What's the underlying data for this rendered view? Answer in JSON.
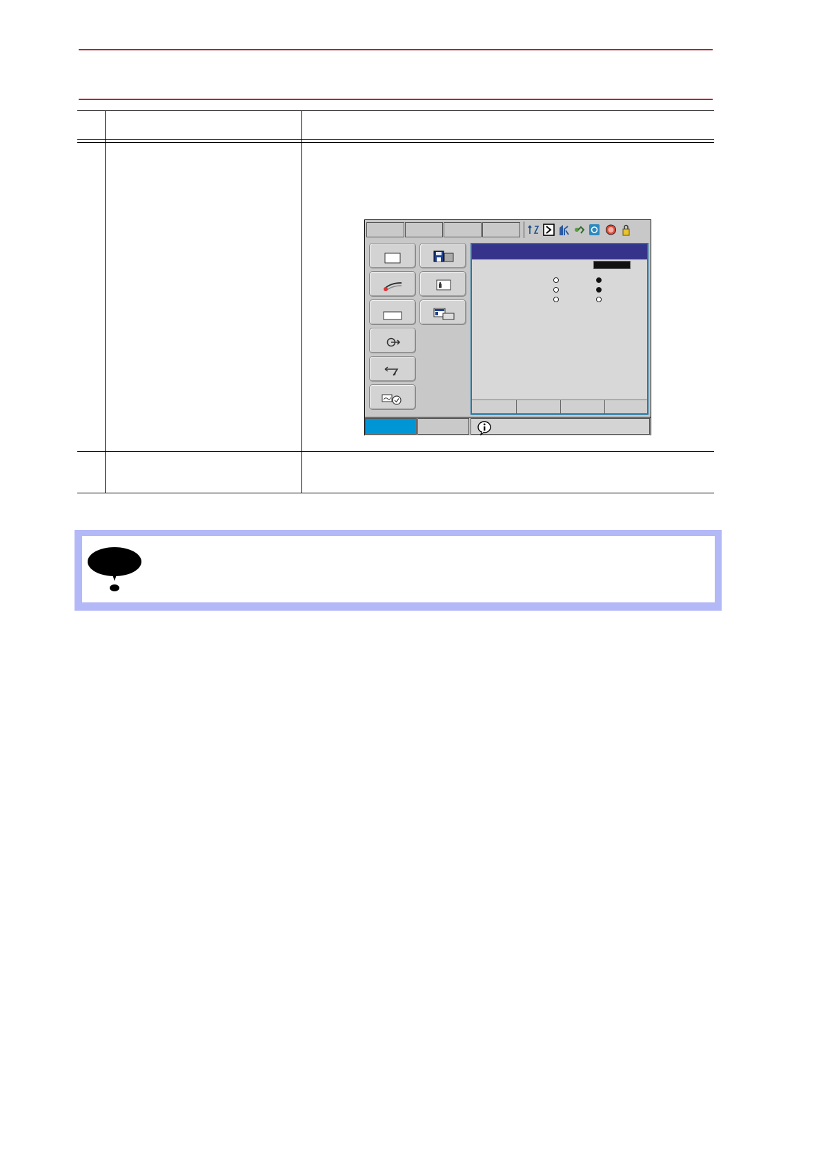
{
  "document": {
    "header_rules": [
      "top",
      "bottom"
    ],
    "table": {
      "rows": [
        {
          "row": "header",
          "step": "",
          "operation": "",
          "explanation": ""
        },
        {
          "row": "step",
          "step": "",
          "operation": "",
          "explanation": ""
        },
        {
          "row": "step",
          "step": "",
          "operation": "",
          "explanation": ""
        }
      ]
    }
  },
  "pendant_screen": {
    "top_tabs": [
      "",
      "",
      "",
      ""
    ],
    "status_icons": [
      "sync-icon",
      "mode-icon",
      "tool-icon",
      "robot-icon",
      "cycle-icon",
      "stop-icon",
      "lock-icon"
    ],
    "main_menu": [
      "job-icon",
      "arc-welding-icon",
      "variable-icon",
      "in-out-icon",
      "robot-icon",
      "system-info-icon"
    ],
    "sub_menu": [
      "save-icon",
      "setup-icon",
      "display-setup-icon"
    ],
    "panel": {
      "title": "",
      "field_value": "",
      "radio_rows": [
        {
          "left": false,
          "right": true
        },
        {
          "left": false,
          "right": true
        },
        {
          "left": false,
          "right": false
        }
      ],
      "footer_buttons": [
        "",
        "",
        "",
        ""
      ]
    },
    "bottom_bar": {
      "main_menu_label": "",
      "simple_menu_label": "",
      "message": "",
      "info_icon": "info-icon"
    },
    "colors": {
      "main_menu_active": "#0096d6",
      "title_bar": "#35348a",
      "panel_border": "#1f78a8"
    }
  },
  "note": {
    "icon": "caution-speech-icon",
    "text": ""
  },
  "colors": {
    "header_rule": "#b8232f",
    "note_border": "#b3b8f7"
  }
}
